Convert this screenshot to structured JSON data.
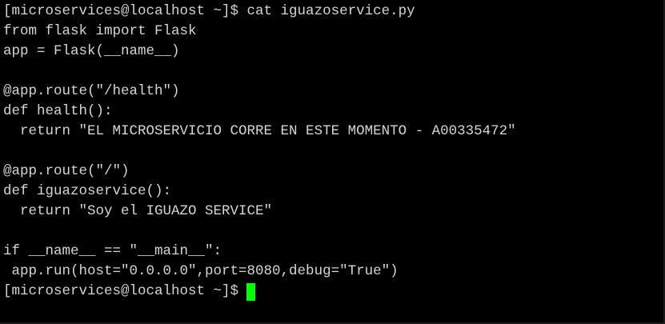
{
  "terminal": {
    "lines": [
      "[microservices@localhost ~]$ cat iguazoservice.py",
      "from flask import Flask",
      "app = Flask(__name__)",
      "",
      "@app.route(\"/health\")",
      "def health():",
      "  return \"EL MICROSERVICIO CORRE EN ESTE MOMENTO - A00335472\"",
      "",
      "@app.route(\"/\")",
      "def iguazoservice():",
      "  return \"Soy el IGUAZO SERVICE\"",
      "",
      "if __name__ == \"__main__\":",
      " app.run(host=\"0.0.0.0\",port=8080,debug=\"True\")"
    ],
    "prompt": "[microservices@localhost ~]$",
    "cursor_color": "#00ff00",
    "text_color": "#d4d4d4",
    "background_color": "#000000"
  }
}
